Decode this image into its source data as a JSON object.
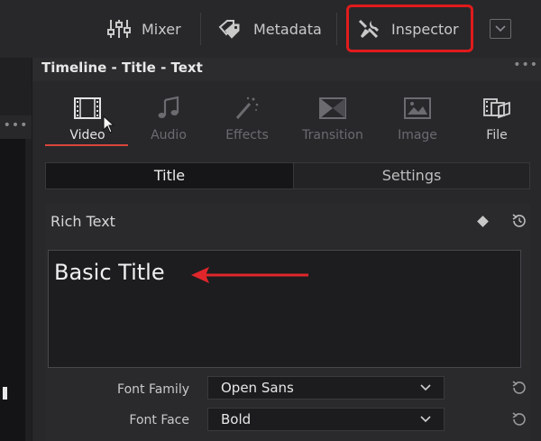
{
  "toolbar": {
    "mixer_label": "Mixer",
    "metadata_label": "Metadata",
    "inspector_label": "Inspector"
  },
  "panel": {
    "title": "Timeline - Title - Text",
    "tabs": [
      {
        "label": "Video",
        "icon": "film-strip-icon",
        "state": "active"
      },
      {
        "label": "Audio",
        "icon": "music-note-icon",
        "state": "disabled"
      },
      {
        "label": "Effects",
        "icon": "magic-wand-icon",
        "state": "disabled"
      },
      {
        "label": "Transition",
        "icon": "transition-icon",
        "state": "disabled"
      },
      {
        "label": "Image",
        "icon": "image-icon",
        "state": "disabled"
      },
      {
        "label": "File",
        "icon": "file-icon",
        "state": "enabled"
      }
    ],
    "subtabs": {
      "title": "Title",
      "settings": "Settings"
    },
    "rich_text": {
      "label": "Rich Text",
      "value": "Basic Title"
    },
    "font_family": {
      "label": "Font Family",
      "value": "Open Sans"
    },
    "font_face": {
      "label": "Font Face",
      "value": "Bold"
    }
  },
  "colors": {
    "accent_underline": "#d8453a",
    "highlight_box": "#e01b1b",
    "arrow": "#e0262a"
  }
}
